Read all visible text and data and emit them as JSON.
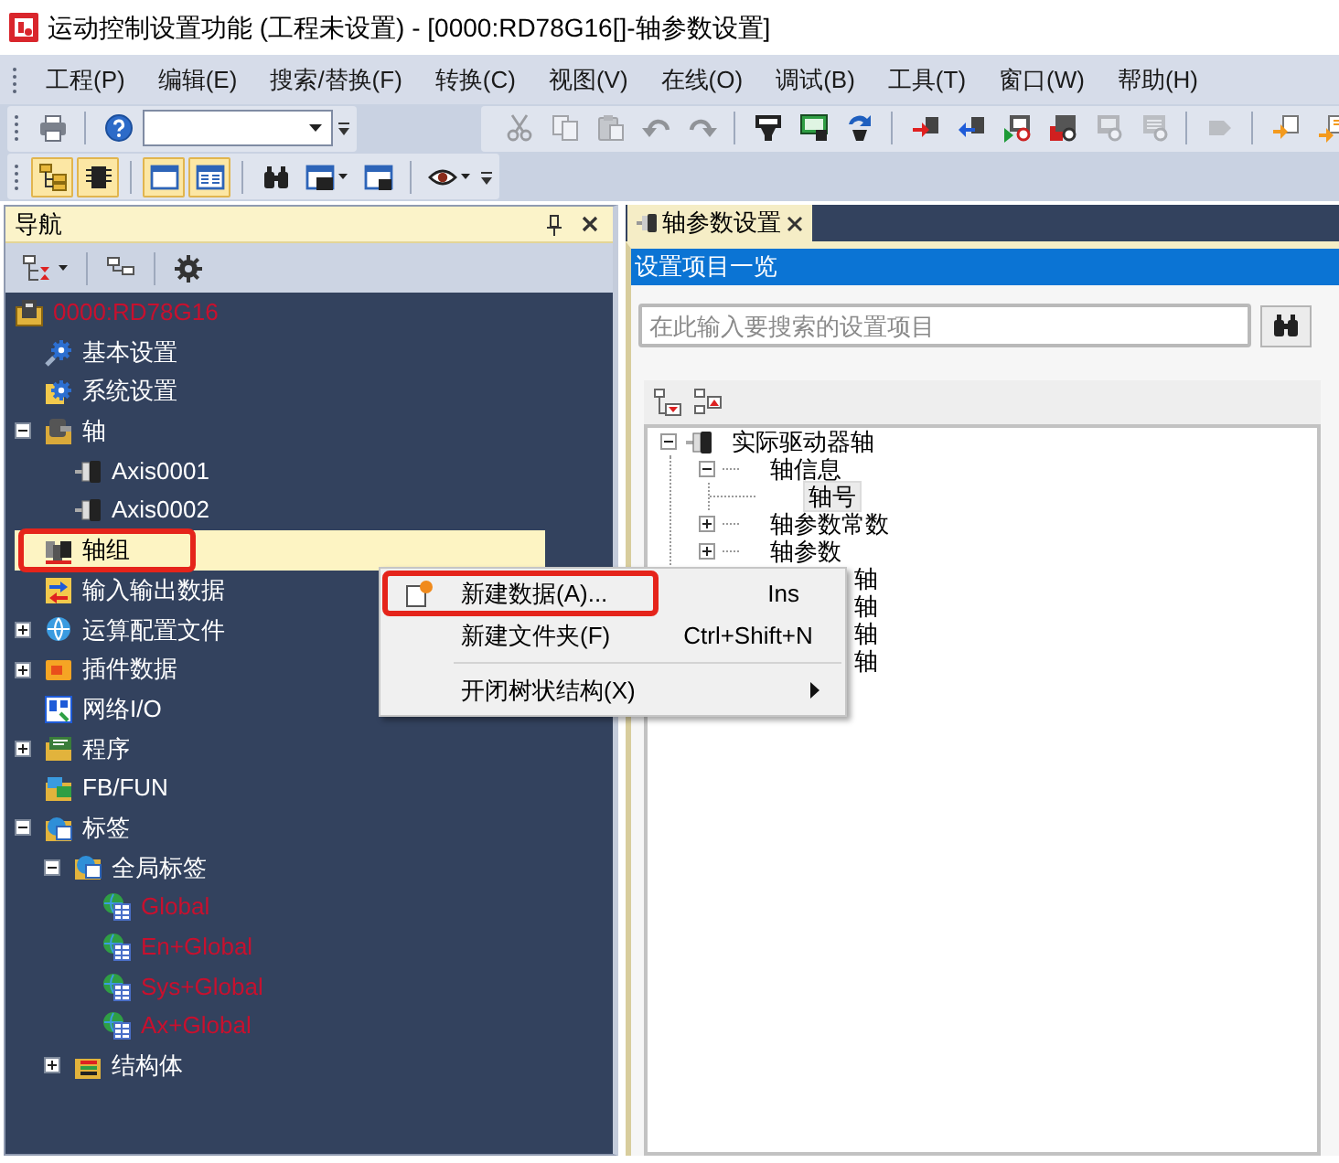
{
  "window": {
    "title": "运动控制设置功能 (工程未设置) - [0000:RD78G16[]-轴参数设置]"
  },
  "menu_bar": [
    "工程(P)",
    "编辑(E)",
    "搜索/替换(F)",
    "转换(C)",
    "视图(V)",
    "在线(O)",
    "调试(B)",
    "工具(T)",
    "窗口(W)",
    "帮助(H)"
  ],
  "toolbar_rows": [
    [
      {
        "groups": [
          [
            {
              "kind": "print",
              "disabled": false
            }
          ],
          [
            {
              "kind": "help",
              "disabled": false
            },
            {
              "kind": "combo",
              "disabled": false
            }
          ]
        ]
      },
      {
        "groups": [
          [
            {
              "kind": "cut",
              "disabled": true
            },
            {
              "kind": "copy",
              "disabled": true
            },
            {
              "kind": "paste",
              "disabled": true
            },
            {
              "kind": "undo",
              "disabled": true
            },
            {
              "kind": "redo",
              "disabled": true
            }
          ],
          [
            {
              "kind": "convert",
              "disabled": false
            },
            {
              "kind": "convertall",
              "disabled": false
            },
            {
              "kind": "rebuild",
              "disabled": false
            }
          ],
          [
            {
              "kind": "write",
              "disabled": false
            },
            {
              "kind": "read",
              "disabled": false
            },
            {
              "kind": "verify",
              "disabled": false
            },
            {
              "kind": "monitor",
              "disabled": false
            },
            {
              "kind": "stopmonitor",
              "disabled": true
            },
            {
              "kind": "watchlist",
              "disabled": true
            }
          ],
          [
            {
              "kind": "step",
              "disabled": true
            }
          ],
          [
            {
              "kind": "previous",
              "disabled": false
            },
            {
              "kind": "next",
              "disabled": false
            }
          ]
        ]
      }
    ],
    [
      {
        "groups": [
          [
            {
              "kind": "navigation",
              "on": true
            },
            {
              "kind": "module",
              "on": true
            }
          ],
          [
            {
              "kind": "window",
              "on": true
            },
            {
              "kind": "splitwindow",
              "on": true
            }
          ],
          [
            {
              "kind": "find",
              "on": false
            },
            {
              "kind": "windowlist",
              "on": false
            },
            {
              "kind": "windowsave",
              "on": false
            }
          ],
          [
            {
              "kind": "watch",
              "on": false
            }
          ]
        ]
      }
    ]
  ],
  "navigation": {
    "title": "导航",
    "tree": [
      {
        "label": "0000:RD78G16",
        "kind": "project",
        "selected": false,
        "color": "#c8102e",
        "children": [
          {
            "label": "基本设置",
            "kind": "basic",
            "selected": false
          },
          {
            "label": "系统设置",
            "kind": "system",
            "selected": false
          },
          {
            "label": "轴",
            "kind": "axes",
            "expanded": true,
            "selected": false,
            "children": [
              {
                "label": "Axis0001",
                "kind": "axis",
                "selected": false
              },
              {
                "label": "Axis0002",
                "kind": "axis",
                "selected": false
              }
            ]
          },
          {
            "label": "轴组",
            "kind": "group",
            "selected": true,
            "annotated": true
          },
          {
            "label": "输入输出数据",
            "kind": "io",
            "selected": false
          },
          {
            "label": "运算配置文件",
            "kind": "profile",
            "expanded": false,
            "selected": false
          },
          {
            "label": "插件数据",
            "kind": "plugin",
            "expanded": false,
            "selected": false
          },
          {
            "label": "网络I/O",
            "kind": "network",
            "selected": false
          },
          {
            "label": "程序",
            "kind": "program",
            "expanded": false,
            "selected": false
          },
          {
            "label": "FB/FUN",
            "kind": "fb",
            "selected": false
          },
          {
            "label": "标签",
            "kind": "labels",
            "expanded": true,
            "selected": false,
            "children": [
              {
                "label": "全局标签",
                "kind": "globals",
                "expanded": true,
                "selected": false,
                "children": [
                  {
                    "label": "Global",
                    "kind": "global",
                    "selected": false,
                    "color": "#c8102e"
                  },
                  {
                    "label": "En+Global",
                    "kind": "global",
                    "selected": false,
                    "color": "#c8102e"
                  },
                  {
                    "label": "Sys+Global",
                    "kind": "global",
                    "selected": false,
                    "color": "#c8102e"
                  },
                  {
                    "label": "Ax+Global",
                    "kind": "global",
                    "selected": false,
                    "color": "#c8102e"
                  }
                ]
              },
              {
                "label": "结构体",
                "kind": "struct",
                "expanded": false,
                "selected": false
              }
            ]
          }
        ]
      }
    ]
  },
  "document_tabs": [
    {
      "label": "轴参数设置",
      "selected": true
    }
  ],
  "settings_panel": {
    "title": "设置项目一览",
    "search": {
      "placeholder": "在此输入要搜索的设置项目"
    },
    "tree": [
      {
        "label": "实际驱动器轴",
        "kind": "drive",
        "expanded": true,
        "selected": false,
        "children": [
          {
            "label": "轴信息",
            "kind": "node",
            "expanded": true,
            "selected": false,
            "children": [
              {
                "label": "轴号",
                "kind": "node",
                "selected": true
              }
            ]
          },
          {
            "label": "轴参数常数",
            "kind": "node",
            "expanded": false,
            "selected": false
          },
          {
            "label": "轴参数",
            "kind": "node",
            "expanded": false,
            "selected": false
          }
        ]
      },
      {
        "label": "轴",
        "kind": "partial",
        "selected": false
      },
      {
        "label": "轴",
        "kind": "partial",
        "selected": false
      },
      {
        "label": "轴",
        "kind": "partial",
        "selected": false
      },
      {
        "label": "轴",
        "kind": "partial",
        "selected": false
      }
    ]
  },
  "context_menu": {
    "groups": [
      [
        {
          "label": "新建数据(A)...",
          "shortcut": "Ins",
          "has_icon": true,
          "submenu": false,
          "annotated": true
        },
        {
          "label": "新建文件夹(F)",
          "shortcut": "Ctrl+Shift+N",
          "has_icon": false,
          "submenu": false
        }
      ],
      [
        {
          "label": "开闭树状结构(X)",
          "has_icon": false,
          "submenu": true
        }
      ]
    ]
  }
}
